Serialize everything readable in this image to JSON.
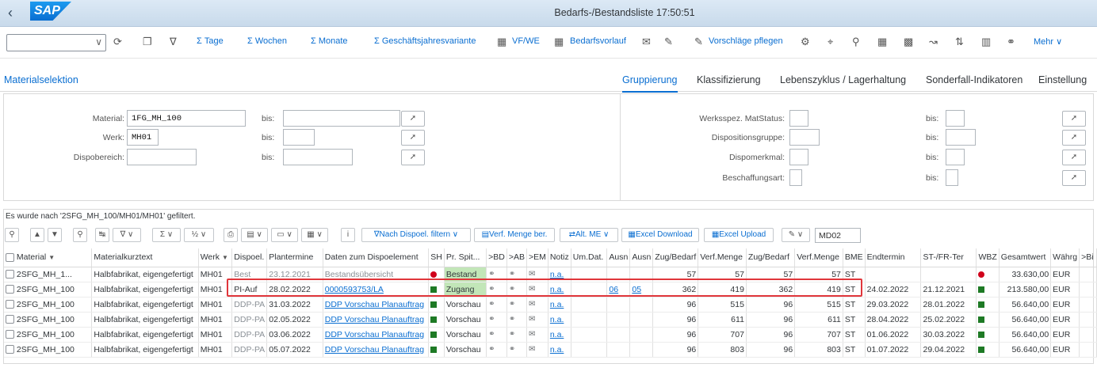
{
  "shell": {
    "back_icon": "chevron-left-icon",
    "logo_text": "SAP",
    "title": "Bedarfs-/Bestandsliste 17:50:51"
  },
  "toolbar": {
    "items": {
      "tage": "Σ  Tage",
      "wochen": "Σ  Wochen",
      "monate": "Σ  Monate",
      "gj": "Σ  Geschäftsjahresvariante",
      "vfwe": "VF/WE",
      "bedarfsvorlauf": "Bedarfsvorlauf",
      "vorschlaege": "Vorschläge pflegen",
      "mehr": "Mehr"
    }
  },
  "tabs": {
    "left": "Materialselektion",
    "items": [
      "Gruppierung",
      "Klassifizierung",
      "Lebenszyklus / Lagerhaltung",
      "Sonderfall-Indikatoren",
      "Einstellung"
    ],
    "active": "Gruppierung"
  },
  "selection": {
    "material_label": "Material:",
    "material_value": "1FG_MH_100",
    "werk_label": "Werk:",
    "werk_value": "MH01",
    "dispobereich_label": "Dispobereich:",
    "bis": "bis:",
    "werksspez_label": "Werksspez. MatStatus:",
    "dispositionsgruppe_label": "Dispositionsgruppe:",
    "dispomerkmal_label": "Dispomerkmal:",
    "beschaffungsart_label": "Beschaffungsart:"
  },
  "table_area": {
    "filter_message": "Es wurde nach '2SFG_MH_100/MH01/MH01' gefiltert.",
    "buttons": {
      "nach_dispoel": "Nach Dispoel. filtern",
      "verf_menge": "Verf. Menge ber.",
      "alt_me": "Alt. ME",
      "excel_download": "Excel Download",
      "excel_upload": "Excel Upload"
    },
    "md_input": "MD02"
  },
  "grid": {
    "headers": [
      "Material",
      "Materialkurztext",
      "Werk",
      "Dispoel.",
      "Plantermine",
      "Daten zum Dispoelement",
      "SH",
      "Pr. Spit...",
      ">BD",
      ">AB",
      ">EM",
      "Notiz",
      "Um.Dat.",
      "Ausn",
      "Ausn",
      "Zug/Bedarf",
      "Verf.Menge",
      "Zug/Bedarf",
      "Verf.Menge",
      "BME",
      "Endtermin",
      "ST-/FR-Ter",
      "WBZ",
      "Gesamtwert",
      "Währg",
      ">Bi"
    ],
    "rows": [
      {
        "material": "2SFG_MH_1...",
        "text": "Halbfabrikat, eigengefertigt",
        "werk": "MH01",
        "dispoel": "Best",
        "datum": "23.12.2021",
        "daten": "Bestandsübersicht",
        "pr": "Bestand",
        "notiz": "n.a.",
        "ausn1": "",
        "ausn2": "",
        "zug": "57",
        "verf": "57",
        "zug2": "57",
        "verf2": "57",
        "bme": "ST",
        "end": "",
        "st": "",
        "gesamt": "33.630,00",
        "waehrg": "EUR"
      },
      {
        "material": "2SFG_MH_100",
        "text": "Halbfabrikat, eigengefertigt",
        "werk": "MH01",
        "dispoel": "PI-Auf",
        "datum": "28.02.2022",
        "daten": "0000593753/LA",
        "pr": "Zugang",
        "notiz": "n.a.",
        "ausn1": "06",
        "ausn2": "05",
        "zug": "362",
        "verf": "419",
        "zug2": "362",
        "verf2": "419",
        "bme": "ST",
        "end": "24.02.2022",
        "st": "21.12.2021",
        "gesamt": "213.580,00",
        "waehrg": "EUR"
      },
      {
        "material": "2SFG_MH_100",
        "text": "Halbfabrikat, eigengefertigt",
        "werk": "MH01",
        "dispoel": "DDP-PA",
        "datum": "31.03.2022",
        "daten": "DDP Vorschau Planauftrag",
        "pr": "Vorschau",
        "notiz": "n.a.",
        "ausn1": "",
        "ausn2": "",
        "zug": "96",
        "verf": "515",
        "zug2": "96",
        "verf2": "515",
        "bme": "ST",
        "end": "29.03.2022",
        "st": "28.01.2022",
        "gesamt": "56.640,00",
        "waehrg": "EUR"
      },
      {
        "material": "2SFG_MH_100",
        "text": "Halbfabrikat, eigengefertigt",
        "werk": "MH01",
        "dispoel": "DDP-PA",
        "datum": "02.05.2022",
        "daten": "DDP Vorschau Planauftrag",
        "pr": "Vorschau",
        "notiz": "n.a.",
        "ausn1": "",
        "ausn2": "",
        "zug": "96",
        "verf": "611",
        "zug2": "96",
        "verf2": "611",
        "bme": "ST",
        "end": "28.04.2022",
        "st": "25.02.2022",
        "gesamt": "56.640,00",
        "waehrg": "EUR"
      },
      {
        "material": "2SFG_MH_100",
        "text": "Halbfabrikat, eigengefertigt",
        "werk": "MH01",
        "dispoel": "DDP-PA",
        "datum": "03.06.2022",
        "daten": "DDP Vorschau Planauftrag",
        "pr": "Vorschau",
        "notiz": "n.a.",
        "ausn1": "",
        "ausn2": "",
        "zug": "96",
        "verf": "707",
        "zug2": "96",
        "verf2": "707",
        "bme": "ST",
        "end": "01.06.2022",
        "st": "30.03.2022",
        "gesamt": "56.640,00",
        "waehrg": "EUR"
      },
      {
        "material": "2SFG_MH_100",
        "text": "Halbfabrikat, eigengefertigt",
        "werk": "MH01",
        "dispoel": "DDP-PA",
        "datum": "05.07.2022",
        "daten": "DDP Vorschau Planauftrag",
        "pr": "Vorschau",
        "notiz": "n.a.",
        "ausn1": "",
        "ausn2": "",
        "zug": "96",
        "verf": "803",
        "zug2": "96",
        "verf2": "803",
        "bme": "ST",
        "end": "01.07.2022",
        "st": "29.04.2022",
        "gesamt": "56.640,00",
        "waehrg": "EUR"
      }
    ]
  },
  "colors": {
    "accent": "#0a6ed1",
    "status_green": "#1e7a25",
    "status_red": "#d0021b",
    "highlight": "#e0363b"
  }
}
